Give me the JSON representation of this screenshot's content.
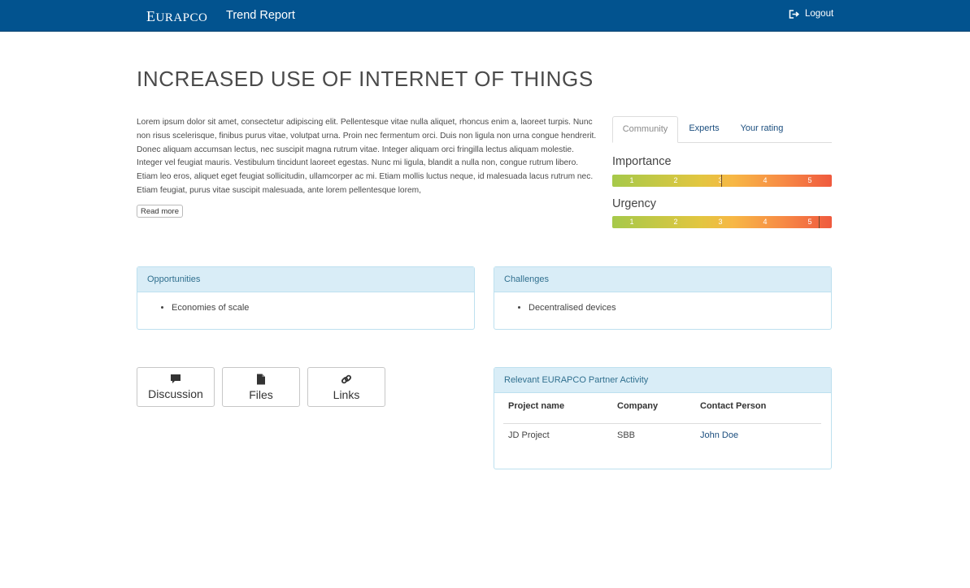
{
  "nav": {
    "brand_first": "E",
    "brand_rest": "URAPCO",
    "title": "Trend Report",
    "logout": "Logout"
  },
  "page": {
    "title": "INCREASED USE OF INTERNET OF THINGS",
    "description": "Lorem ipsum dolor sit amet, consectetur adipiscing elit. Pellentesque vitae nulla aliquet, rhoncus enim a, laoreet turpis. Nunc non risus scelerisque, finibus purus vitae, volutpat urna. Proin nec fermentum orci. Duis non ligula non urna congue hendrerit. Donec aliquam accumsan lectus, nec suscipit magna rutrum vitae. Integer aliquam orci fringilla lectus aliquam molestie. Integer vel feugiat mauris. Vestibulum tincidunt laoreet egestas. Nunc mi ligula, blandit a nulla non, congue rutrum libero. Etiam leo eros, aliquet eget feugiat sollicitudin, ullamcorper ac mi. Etiam mollis luctus neque, id malesuada lacus rutrum nec. Etiam feugiat, purus vitae suscipit malesuada, ante lorem pellentesque lorem,",
    "read_more": "Read more"
  },
  "tabs": [
    {
      "label": "Community",
      "active": true
    },
    {
      "label": "Experts",
      "active": false
    },
    {
      "label": "Your rating",
      "active": false
    }
  ],
  "ratings": {
    "scale": [
      "1",
      "2",
      "3",
      "4",
      "5"
    ],
    "importance": {
      "label": "Importance",
      "value": 3.0
    },
    "urgency": {
      "label": "Urgency",
      "value": 5.2
    }
  },
  "opportunities": {
    "title": "Opportunities",
    "items": [
      "Economies of scale"
    ]
  },
  "challenges": {
    "title": "Challenges",
    "items": [
      "Decentralised devices"
    ]
  },
  "tools": [
    {
      "label": "Discussion",
      "icon": "comment-icon"
    },
    {
      "label": "Files",
      "icon": "file-icon"
    },
    {
      "label": "Links",
      "icon": "link-icon"
    }
  ],
  "partner_activity": {
    "title": "Relevant EURAPCO Partner Activity",
    "columns": [
      "Project name",
      "Company",
      "Contact Person"
    ],
    "rows": [
      [
        "JD Project",
        "SBB",
        "John Doe"
      ]
    ]
  },
  "colors": {
    "navbar": "#02538f",
    "panel_heading": "#d9edf7",
    "link": "#1a4d7e"
  }
}
